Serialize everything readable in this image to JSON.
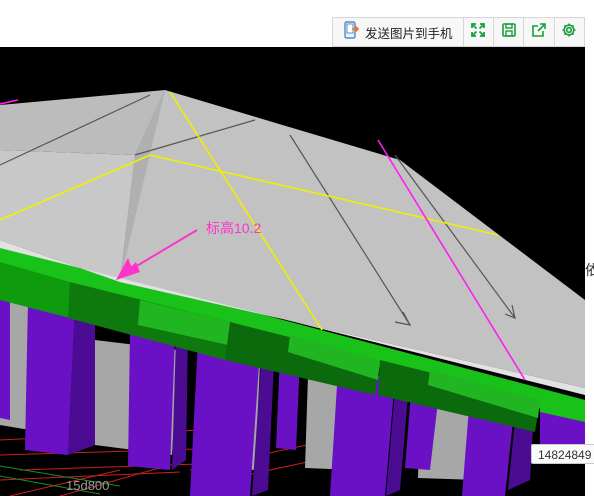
{
  "toolbar": {
    "send_label": "发送图片到手机",
    "send_icon": "phone-send-icon",
    "buttons": [
      {
        "name": "fullscreen-button",
        "icon": "fullscreen-icon"
      },
      {
        "name": "save-button",
        "icon": "save-icon"
      },
      {
        "name": "share-button",
        "icon": "share-icon"
      },
      {
        "name": "settings-button",
        "icon": "gear-icon"
      }
    ],
    "accent_color": "#1a9e3c"
  },
  "viewport": {
    "annotation_text": "标高10.2",
    "annotation_color": "#ff33cc",
    "bottom_label": "15d800"
  },
  "side_glyph": "依",
  "tooltip_text": "14824849"
}
